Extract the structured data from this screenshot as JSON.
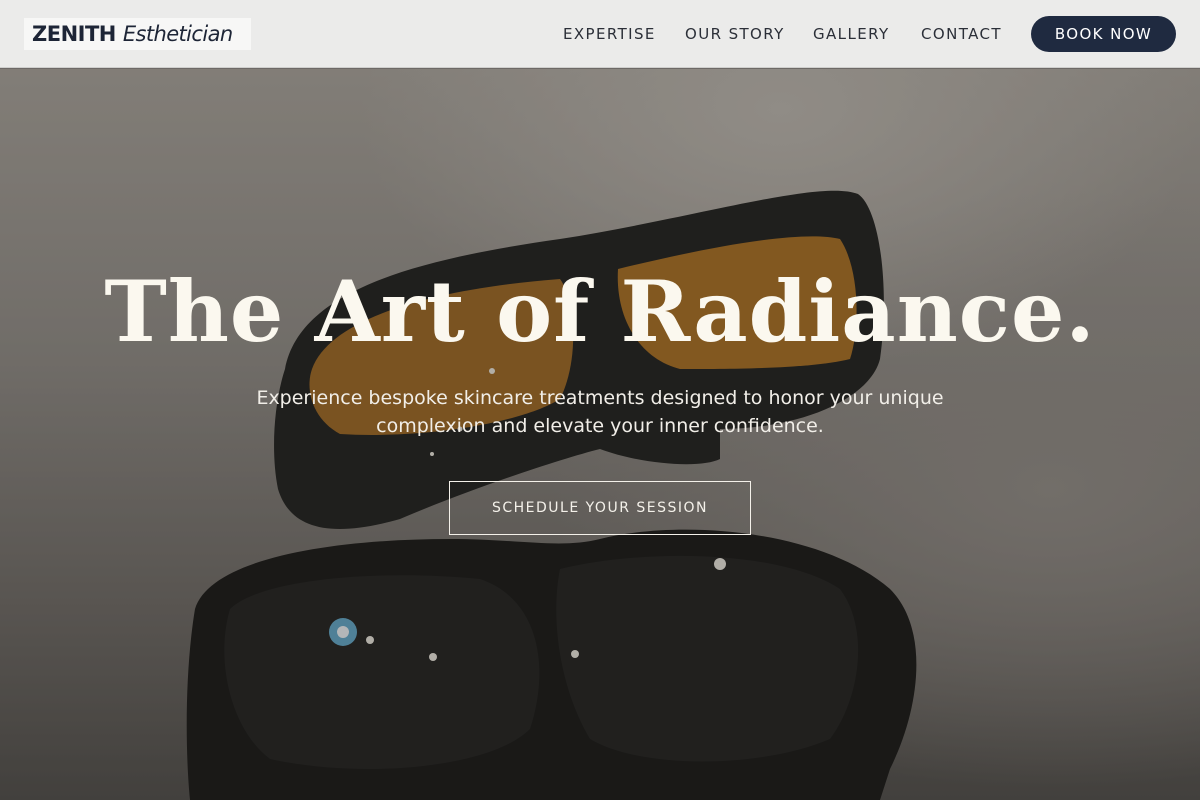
{
  "header": {
    "logo_word": "ZENITH",
    "logo_sub": "Esthetician",
    "nav": {
      "expertise": "EXPERTISE",
      "our_story": "OUR STORY",
      "gallery": "GALLERY",
      "contact": "CONTACT"
    },
    "book_now": "BOOK NOW"
  },
  "hero": {
    "title": "The Art of Radiance.",
    "subtitle": "Experience bespoke skincare treatments designed to honor your unique complexion and elevate your inner confidence.",
    "cta": "SCHEDULE YOUR SESSION"
  },
  "colors": {
    "header_bg": "#ebebea",
    "accent_navy": "#1f2a40",
    "hero_text": "#fbf8ef"
  }
}
